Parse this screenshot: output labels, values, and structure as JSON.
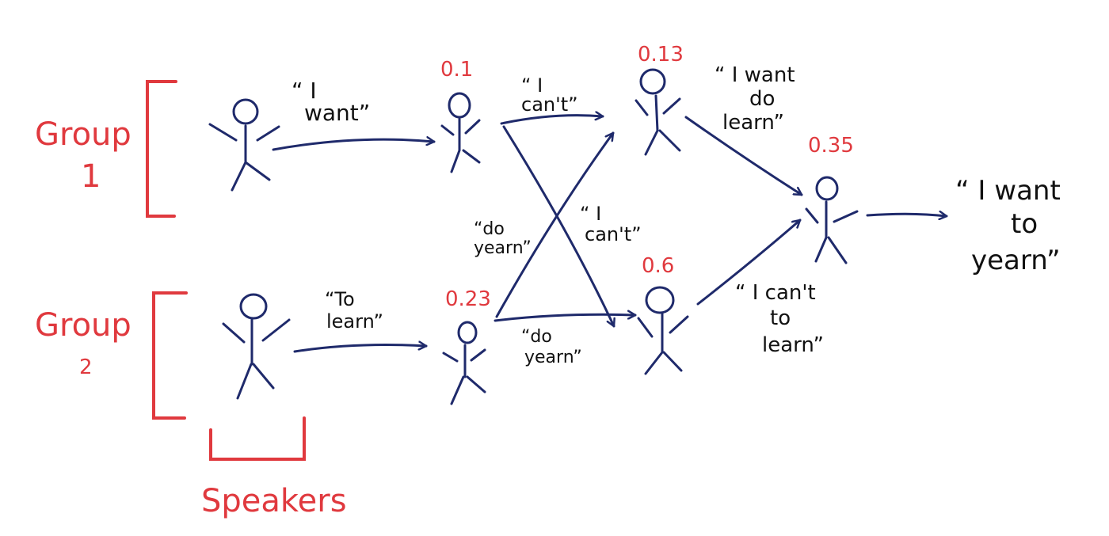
{
  "colors": {
    "ink": "#1f2a6b",
    "label": "#111111",
    "annotation": "#e0393e"
  },
  "groups": [
    {
      "label_line1": "Group",
      "label_line2": "1"
    },
    {
      "label_line1": "Group",
      "label_line2": "2"
    }
  ],
  "speakers_label": "Speakers",
  "nodes": {
    "g1_speaker": {
      "score": ""
    },
    "g2_speaker": {
      "score": ""
    },
    "g1_listener": {
      "score": "0.1"
    },
    "g2_listener": {
      "score": "0.23"
    },
    "g1_mid": {
      "score": "0.13"
    },
    "g2_mid": {
      "score": "0.6"
    },
    "final": {
      "score": "0.35"
    }
  },
  "utterances": {
    "g1_speaker_to_g1_listener": {
      "line1": "“ I",
      "line2": "want”"
    },
    "g2_speaker_to_g2_listener": {
      "line1": "“To",
      "line2": "learn”"
    },
    "g1_listener_to_g1_mid": {
      "line1": "“ I",
      "line2": "can't”"
    },
    "g1_listener_to_g2_mid": {
      "line1": "“ I",
      "line2": "can't”"
    },
    "g2_listener_to_g1_mid": {
      "line1": "“do",
      "line2": "yearn”"
    },
    "g2_listener_to_g2_mid": {
      "line1": "“do",
      "line2": "yearn”"
    },
    "g1_mid_to_final": {
      "line1": "“ I want",
      "line2": "do",
      "line3": "learn”"
    },
    "g2_mid_to_final": {
      "line1": "“ I can't",
      "line2": "to",
      "line3": "learn”"
    },
    "final_output": {
      "line1": "“ I want",
      "line2": "to",
      "line3": "yearn”"
    }
  }
}
